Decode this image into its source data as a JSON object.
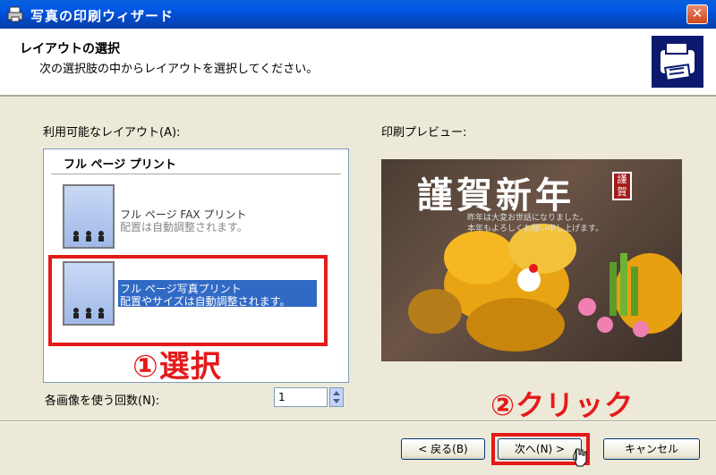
{
  "window": {
    "title": "写真の印刷ウィザード"
  },
  "header": {
    "title": "レイアウトの選択",
    "subtitle": "次の選択肢の中からレイアウトを選択してください。"
  },
  "layouts": {
    "label": "利用可能なレイアウト(A):",
    "group_header": "フル ページ プリント",
    "items": [
      {
        "title": "フル ページ FAX プリント",
        "desc": "配置は自動調整されます。",
        "selected": false
      },
      {
        "title": "フル ページ写真プリント",
        "desc": "配置やサイズは自動調整されます。",
        "selected": true
      }
    ]
  },
  "preview": {
    "label": "印刷プレビュー:",
    "heading": "謹賀新年",
    "line1": "昨年は大変お世話になりました。",
    "line2": "本年もよろしくお願い申し上げます。",
    "stamp": "謹賀"
  },
  "copies": {
    "label": "各画像を使う回数(N):",
    "value": "1"
  },
  "annotations": {
    "step1": "①選択",
    "step2": "②クリック"
  },
  "buttons": {
    "back": "< 戻る(B)",
    "next": "次へ(N) >",
    "cancel": "キャンセル"
  },
  "colors": {
    "accent_red": "#e41a1a",
    "selection_blue": "#316ac5",
    "titlebar_blue": "#0058e6"
  }
}
